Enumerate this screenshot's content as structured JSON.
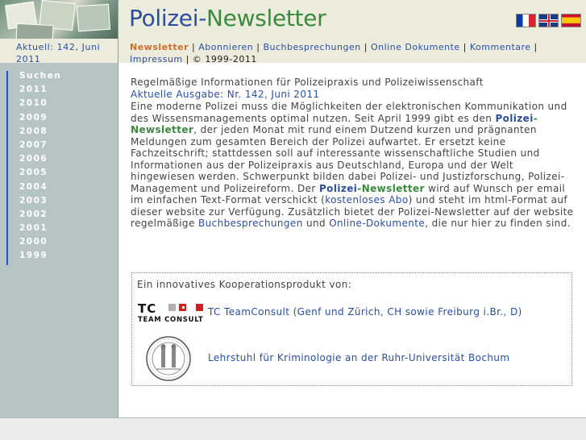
{
  "header": {
    "title_part1": "Polizei",
    "title_dash": "-",
    "title_part2": "Newsletter",
    "flags": [
      "flag-fr-icon",
      "flag-uk-icon",
      "flag-es-icon"
    ]
  },
  "current": {
    "text": "Aktuell: 142, Juni 2011"
  },
  "nav": {
    "items": [
      "Newsletter",
      "Abonnieren",
      "Buchbesprechungen",
      "Online Dokumente",
      "Kommentare",
      "Impressum"
    ],
    "separator": "|",
    "copyright": "© 1999-2011"
  },
  "sidebar": {
    "items": [
      "Suchen",
      "2011",
      "2010",
      "2009",
      "2008",
      "2007",
      "2006",
      "2005",
      "2004",
      "2003",
      "2002",
      "2001",
      "2000",
      "1999"
    ]
  },
  "main": {
    "intro": "Regelmäßige Informationen für Polizeipraxis und Polizeiwissenschaft",
    "issue_link": "Aktuelle Ausgabe: Nr. 142, Juni 2011",
    "body_1": "Eine moderne Polizei muss die Möglichkeiten der elektronischen Kommunikation und des Wissensmanagements optimal nutzen. Seit April 1999 gibt es den ",
    "brand_p": "Polizei",
    "brand_dash": "-",
    "brand_n": "Newsletter",
    "body_2": ", der jeden Monat mit rund einem Dutzend kurzen und prägnanten Meldungen zum gesamten Bereich der Polizei aufwartet. Er ersetzt keine Fachzeitschrift; stattdessen soll auf interessante wissenschaftliche Studien und Informationen aus der Polizeipraxis aus Deutschland, Europa und der Welt hingewiesen werden. Schwerpunkt bilden dabei Polizei- und Justizforschung, Polizei-Management und Polizeireform. Der ",
    "body_3": " wird auf Wunsch per email im einfachen Text-Format verschickt (",
    "abo_link": "kostenloses Abo",
    "body_4": ") und steht im html-Format auf dieser website zur Verfügung. Zusätzlich bietet der Polizei-Newsletter auf der website regelmäßige ",
    "books_link": "Buchbesprechungen",
    "body_5": " und ",
    "docs_link": "Online-Dokumente",
    "body_6": ", die nur hier zu finden sind."
  },
  "coop": {
    "heading": "Ein innovatives Kooperationsprodukt von:",
    "tc_logo_text": "TC",
    "tc_logo_sub": "TEAM CONSULT",
    "tc_link": "TC TeamConsult (Genf und Zürich, CH sowie Freiburg i.Br., D)",
    "rub_link": "Lehrstuhl für Kriminologie an der Ruhr-Universität Bochum",
    "colors": {
      "tc_gray": "#b0b0b0",
      "tc_red": "#d02020"
    }
  },
  "colors": {
    "link": "#2c4fa0",
    "active_nav": "#c8702a",
    "sidebar": "#b7c4c4",
    "header_bg": "#ececdc"
  }
}
